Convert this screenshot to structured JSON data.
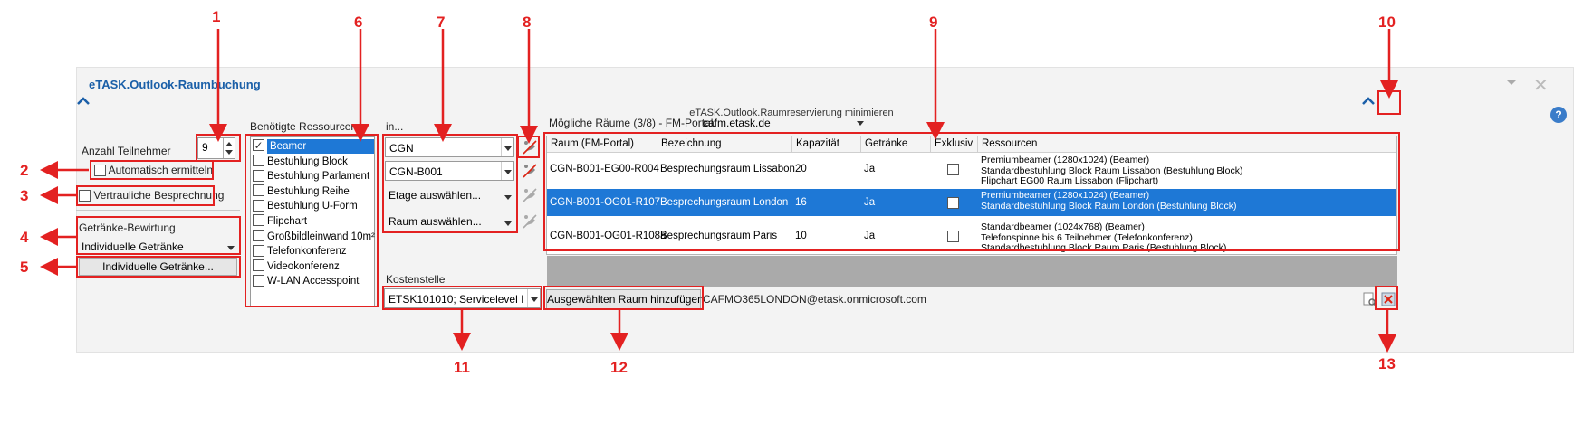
{
  "app_title": "eTASK.Outlook-Raumbuchung",
  "minimize_title": "eTASK.Outlook.Raumreservierung minimieren",
  "participants": {
    "label": "Anzahl Teilnehmer",
    "value": "9",
    "auto_label": "Automatisch ermitteln"
  },
  "confidential_label": "Vertrauliche Besprechnung",
  "drinks": {
    "label": "Getränke-Bewirtung",
    "selected": "Individuelle Getränke",
    "button": "Individuelle Getränke..."
  },
  "resources": {
    "label": "Benötigte Ressourcen",
    "items": [
      {
        "label": "Beamer",
        "checked": true
      },
      {
        "label": "Bestuhlung Block",
        "checked": false
      },
      {
        "label": "Bestuhlung Parlament",
        "checked": false
      },
      {
        "label": "Bestuhlung Reihe",
        "checked": false
      },
      {
        "label": "Bestuhlung U-Form",
        "checked": false
      },
      {
        "label": "Flipchart",
        "checked": false
      },
      {
        "label": "Großbildleinwand 10m²",
        "checked": false
      },
      {
        "label": "Telefonkonferenz",
        "checked": false
      },
      {
        "label": "Videokonferenz",
        "checked": false
      },
      {
        "label": "W-LAN Accesspoint",
        "checked": false
      }
    ]
  },
  "location": {
    "label": "in...",
    "city": "CGN",
    "building": "CGN-B001",
    "floor_placeholder": "Etage auswählen...",
    "room_placeholder": "Raum auswählen..."
  },
  "cost_center": {
    "label": "Kostenstelle",
    "value": "ETSK101010; Servicelevel I"
  },
  "rooms": {
    "header_label": "Mögliche Räume (3/8) - FM-Portal:",
    "portal": "cafm.etask.de",
    "columns": [
      "Raum (FM-Portal)",
      "Bezeichnung",
      "Kapazität",
      "Getränke",
      "Exklusiv",
      "Ressourcen"
    ],
    "rows": [
      {
        "room": "CGN-B001-EG00-R004",
        "name": "Besprechungsraum Lissabon",
        "capacity": "20",
        "drinks": "Ja",
        "resources": [
          "Premiumbeamer (1280x1024) (Beamer)",
          "Standardbestuhlung Block Raum Lissabon (Bestuhlung Block)",
          "Flipchart EG00 Raum Lissabon (Flipchart)"
        ]
      },
      {
        "room": "CGN-B001-OG01-R107",
        "name": "Besprechungsraum London",
        "capacity": "16",
        "drinks": "Ja",
        "resources": [
          "Premiumbeamer (1280x1024) (Beamer)",
          "Standardbestuhlung Block Raum London (Bestuhlung Block)"
        ]
      },
      {
        "room": "CGN-B001-OG01-R108a",
        "name": "Besprechungsraum Paris",
        "capacity": "10",
        "drinks": "Ja",
        "resources": [
          "Standardbeamer (1024x768) (Beamer)",
          "Telefonspinne bis 6 Teilnehmer (Telefonkonferenz)",
          "Standardbestuhlung Block Raum Paris (Bestuhlung Block)"
        ]
      }
    ]
  },
  "add_room_button": "Ausgewählten Raum hinzufügen",
  "selected_email": "CAFMO365LONDON@etask.onmicrosoft.com",
  "callouts": [
    "1",
    "2",
    "3",
    "4",
    "5",
    "6",
    "7",
    "8",
    "9",
    "10",
    "11",
    "12",
    "13"
  ],
  "colors": {
    "accent": "#1e78d6",
    "title": "#1a5fa8",
    "annotation": "#e32121"
  }
}
